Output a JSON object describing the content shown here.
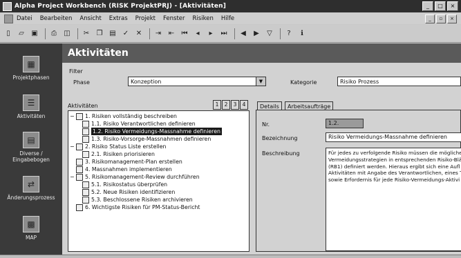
{
  "window": {
    "title": "Alpha Project Workbench (RISK ProjektPRJ) - [Aktivitäten]"
  },
  "menu": [
    "Datei",
    "Bearbeiten",
    "Ansicht",
    "Extras",
    "Projekt",
    "Fenster",
    "Risiken",
    "Hilfe"
  ],
  "toolbar": {
    "icons": [
      "new-icon",
      "open-icon",
      "save-icon",
      "print-icon",
      "preview-icon",
      "cut-icon",
      "copy-icon",
      "paste-icon",
      "check-icon",
      "delete-icon",
      "indent-icon",
      "outdent-icon",
      "first-icon",
      "prev-icon",
      "next-icon",
      "last-icon",
      "back-icon",
      "forward-icon",
      "filter-icon",
      "help-icon",
      "info-icon"
    ]
  },
  "sidebar": {
    "items": [
      {
        "label": "Projektphasen",
        "icon": "phase-icon"
      },
      {
        "label": "Aktivitäten",
        "icon": "activities-icon"
      },
      {
        "label": "Diverse / Eingabebogen",
        "icon": "form-icon"
      },
      {
        "label": "Änderungsprozess",
        "icon": "change-icon"
      },
      {
        "label": "MAP",
        "icon": "map-icon"
      }
    ]
  },
  "main": {
    "title": "Aktivitäten",
    "filter_label": "Filter",
    "phase_label": "Phase",
    "phase_value": "Konzeption",
    "category_label": "Kategorie",
    "category_value": "Risiko Prozess",
    "activities_label": "Aktivitäten",
    "levels": [
      "1",
      "2",
      "3",
      "4"
    ]
  },
  "tree": {
    "rows": [
      {
        "text": "1. Risiken vollständig beschreiben",
        "exp": "−"
      },
      {
        "text": "1.1. Risiko Verantwortlichen definieren",
        "exp": ""
      },
      {
        "text": "1.2. Risiko Vermeidungs-Massnahme definieren",
        "exp": ""
      },
      {
        "text": "1.3. Risiko-Vorsorge-Massnahmen definieren",
        "exp": ""
      },
      {
        "text": "2. Risiko Status Liste erstellen",
        "exp": "−"
      },
      {
        "text": "2.1. Risiken priorisieren",
        "exp": ""
      },
      {
        "text": "3. Risikomanagement-Plan erstellen",
        "exp": ""
      },
      {
        "text": "4. Massnahmen implementieren",
        "exp": ""
      },
      {
        "text": "5. Risikomanagement-Review durchführen",
        "exp": "−"
      },
      {
        "text": "5.1. Risikostatus überprüfen",
        "exp": ""
      },
      {
        "text": "5.2. Neue Risiken identifizieren",
        "exp": ""
      },
      {
        "text": "5.3. Beschlossene Risiken archivieren",
        "exp": ""
      },
      {
        "text": "6. Wichtigste Risiken für PM-Status-Bericht",
        "exp": ""
      }
    ]
  },
  "details": {
    "tabs": [
      "Details",
      "Arbeitsaufträge"
    ],
    "nr_label": "Nr.",
    "nr_value": "1.2.",
    "name_label": "Bezeichnung",
    "name_value": "Risiko Vermeidungs-Massnahme definieren",
    "desc_label": "Beschreibung",
    "desc_lines": [
      "Für jedes zu verfolgende Risiko müssen die möglichen",
      "Vermeidungsstrategien in entsprechenden Risiko-Blättern",
      "(RB1) definiert werden. Hieraus ergibt sich eine Aufl",
      "Aktivitäten mit Angabe des Verantwortlichen, eines T",
      "sowie Erfordernis für jede Risiko-Vermeidungs-Aktivi"
    ]
  }
}
